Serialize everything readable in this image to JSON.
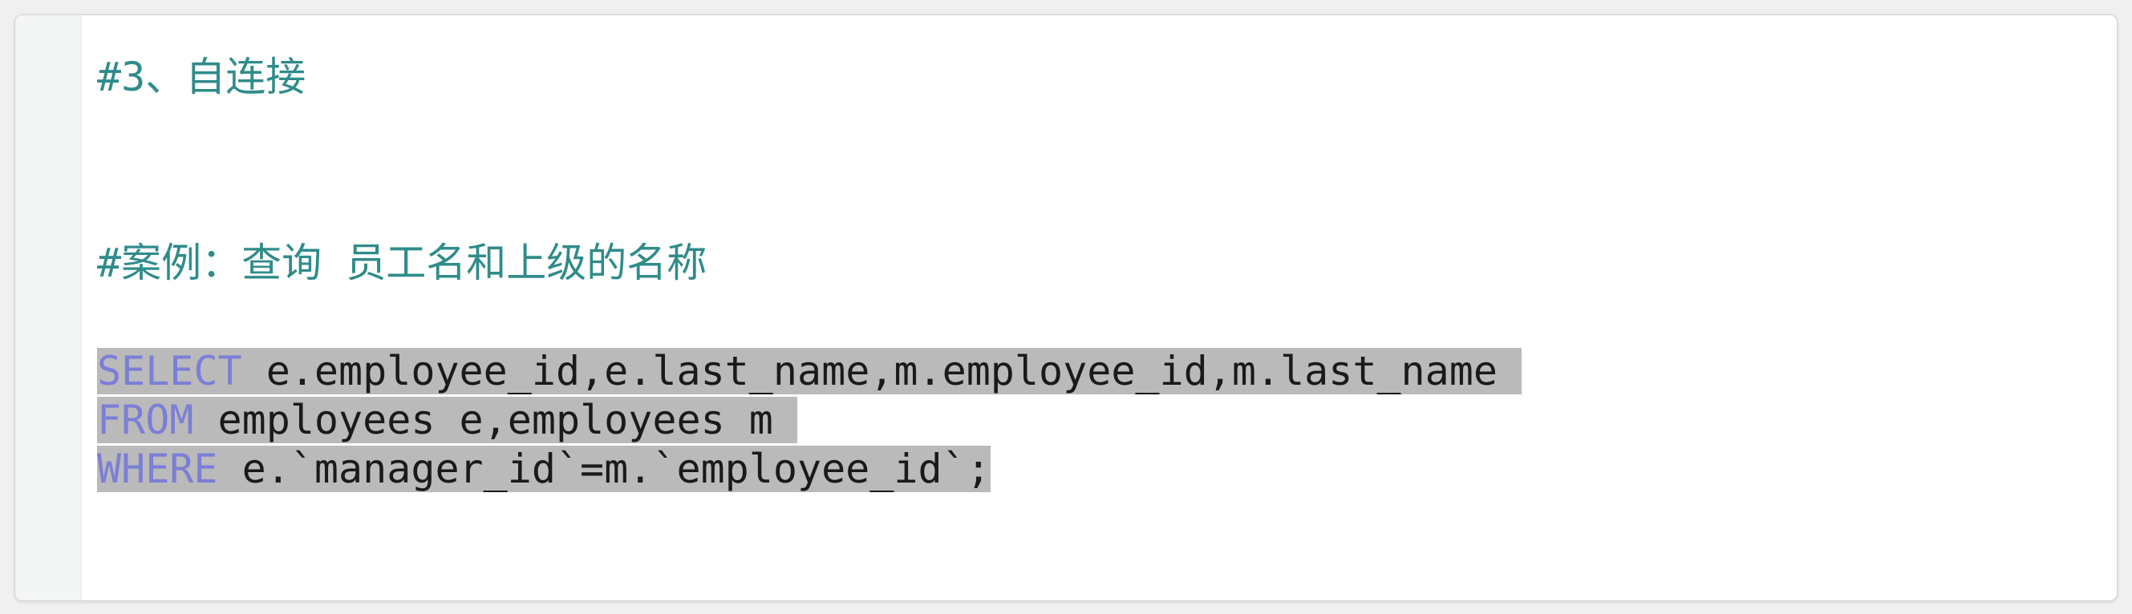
{
  "editor": {
    "lines": [
      {
        "type": "comment",
        "text": "#3、自连接"
      },
      {
        "type": "comment",
        "text": "#案例：查询 员工名和上级的名称"
      },
      {
        "type": "code",
        "keyword": "SELECT",
        "rest": " e.employee_id,e.last_name,m.employee_id,m.last_name "
      },
      {
        "type": "code",
        "keyword": "FROM",
        "rest": " employees e,employees m "
      },
      {
        "type": "code",
        "keyword": "WHERE",
        "rest": " e.`manager_id`=m.`employee_id`;"
      }
    ],
    "colors": {
      "comment": "#2f8c8a",
      "keyword": "#7b7fd6",
      "selection": "#bababa",
      "text": "#1a1a1a"
    }
  }
}
